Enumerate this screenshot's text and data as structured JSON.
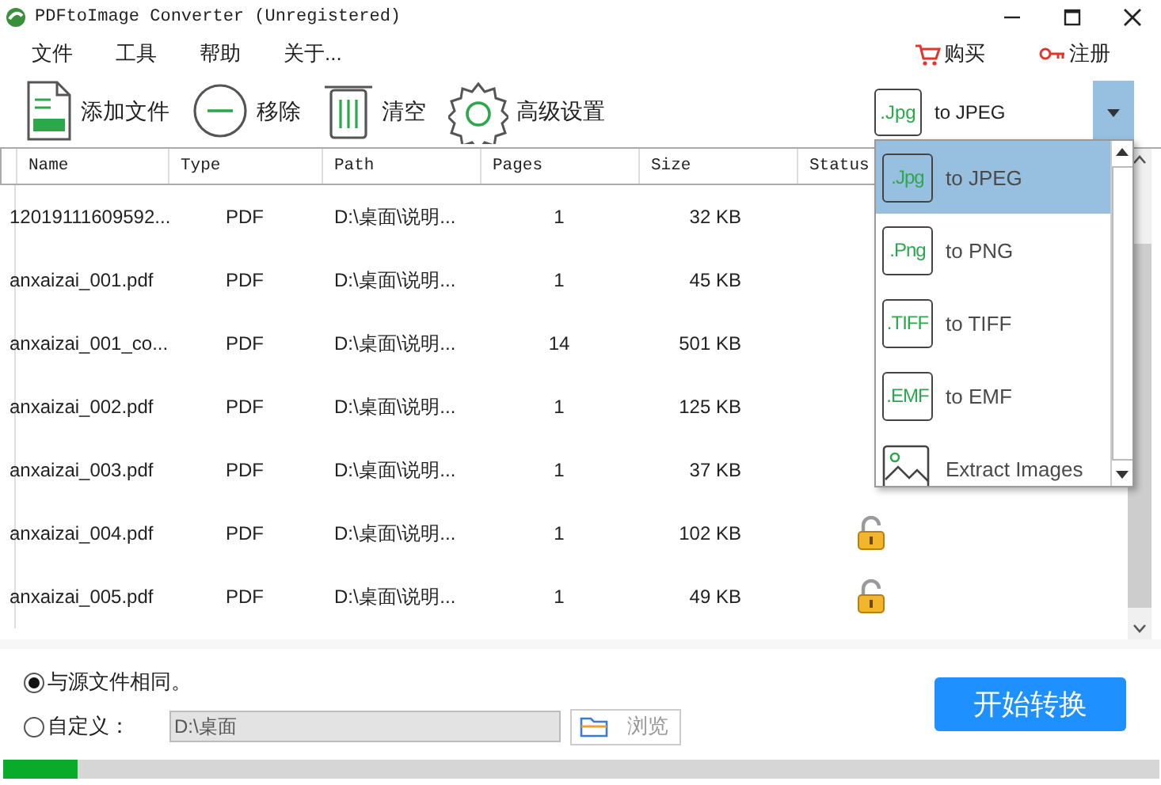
{
  "window": {
    "title": "PDFtoImage Converter (Unregistered)"
  },
  "menu": [
    "文件",
    "工具",
    "帮助",
    "关于..."
  ],
  "top_links": [
    {
      "kind": "cart",
      "label": "购买"
    },
    {
      "kind": "key",
      "label": "注册"
    }
  ],
  "toolbar": [
    {
      "kind": "pdf",
      "label": "添加文件"
    },
    {
      "kind": "minus",
      "label": "移除"
    },
    {
      "kind": "trash",
      "label": "清空"
    },
    {
      "kind": "gear",
      "label": "高级设置"
    }
  ],
  "format_select": {
    "badge": ".Jpg",
    "value": "to JPEG",
    "expanded": true
  },
  "format_options": [
    {
      "kind": "badge",
      "badge": ".Jpg",
      "label": "to JPEG",
      "selected": true
    },
    {
      "kind": "badge",
      "badge": ".Png",
      "label": "to PNG",
      "selected": false
    },
    {
      "kind": "badge",
      "badge": ".TIFF",
      "label": "to TIFF",
      "selected": false
    },
    {
      "kind": "badge",
      "badge": ".EMF",
      "label": "to EMF",
      "selected": false
    },
    {
      "kind": "image",
      "label": "Extract Images",
      "selected": false
    }
  ],
  "table": {
    "columns": [
      "Name",
      "Type",
      "Path",
      "Pages",
      "Size",
      "Status"
    ],
    "rows": [
      {
        "name": "12019111609592...",
        "type": "PDF",
        "path": "D:\\桌面\\说明...",
        "pages": "1",
        "size": "32 KB",
        "locked": false
      },
      {
        "name": "anxaizai_001.pdf",
        "type": "PDF",
        "path": "D:\\桌面\\说明...",
        "pages": "1",
        "size": "45 KB",
        "locked": false
      },
      {
        "name": "anxaizai_001_co...",
        "type": "PDF",
        "path": "D:\\桌面\\说明...",
        "pages": "14",
        "size": "501 KB",
        "locked": false
      },
      {
        "name": "anxaizai_002.pdf",
        "type": "PDF",
        "path": "D:\\桌面\\说明...",
        "pages": "1",
        "size": "125 KB",
        "locked": false
      },
      {
        "name": "anxaizai_003.pdf",
        "type": "PDF",
        "path": "D:\\桌面\\说明...",
        "pages": "1",
        "size": "37 KB",
        "locked": false
      },
      {
        "name": "anxaizai_004.pdf",
        "type": "PDF",
        "path": "D:\\桌面\\说明...",
        "pages": "1",
        "size": "102 KB",
        "locked": true
      },
      {
        "name": "anxaizai_005.pdf",
        "type": "PDF",
        "path": "D:\\桌面\\说明...",
        "pages": "1",
        "size": "49 KB",
        "locked": true
      }
    ]
  },
  "output": {
    "options": [
      {
        "label": "与源文件相同。",
        "selected": true
      },
      {
        "label": "自定义：",
        "selected": false
      }
    ],
    "folder": {
      "value": "D:\\桌面",
      "disabled": true
    },
    "browse": {
      "label": "浏览",
      "disabled": true
    }
  },
  "start_button": "开始转换",
  "progress": {
    "level": 0.065
  }
}
